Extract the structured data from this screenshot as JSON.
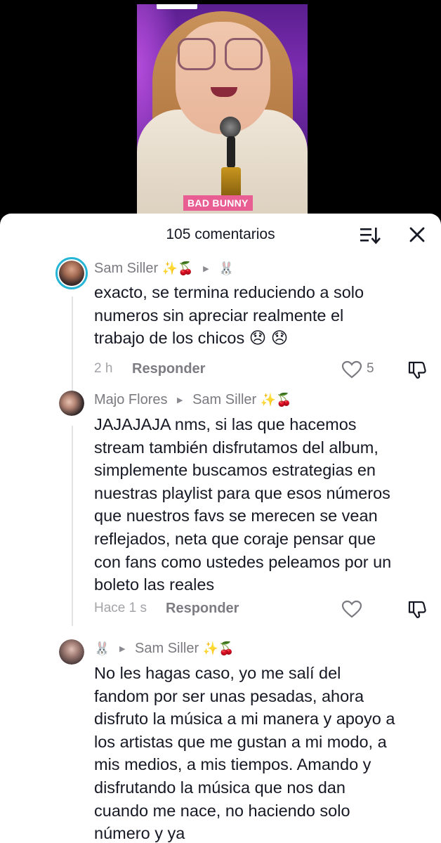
{
  "video": {
    "tag_text": "BAD BUNNY"
  },
  "header": {
    "comment_count": "105 comentarios",
    "sort_icon": "sort-icon",
    "close_icon": "close-icon"
  },
  "comments": [
    {
      "author": "Sam Siller",
      "author_emoji": "✨🍒",
      "reply_to": "🐰",
      "text": "exacto, se termina reduciendo a solo\nnumeros sin apreciar realmente el\ntrabajo de los chicos 😞 😞",
      "time": "2 h",
      "reply_label": "Responder",
      "likes": "5"
    },
    {
      "author": "Majo Flores",
      "reply_to": "Sam Siller",
      "reply_to_emoji": "✨🍒",
      "text": "JAJAJAJA nms, si las que hacemos\nstream también disfrutamos del album,\nsimplemente buscamos estrategias en\nnuestras playlist para que esos números\nque nuestros favs se merecen se vean\nreflejados, neta que coraje pensar que\ncon fans como ustedes peleamos por un\nboleto las reales",
      "time": "Hace 1 s",
      "reply_label": "Responder",
      "likes": ""
    },
    {
      "author": "🐰",
      "reply_to": "Sam Siller",
      "reply_to_emoji": "✨🍒",
      "text": "No les hagas caso, yo me salí del\nfandom por ser unas pesadas, ahora\ndisfruto la música a mi manera y apoyo a\nlos artistas que me gustan a mi modo, a\nmis medios, a mis tiempos. Amando y\ndisfrutando la música que nos dan\ncuando me nace, no haciendo solo\nnúmero y ya"
    }
  ]
}
